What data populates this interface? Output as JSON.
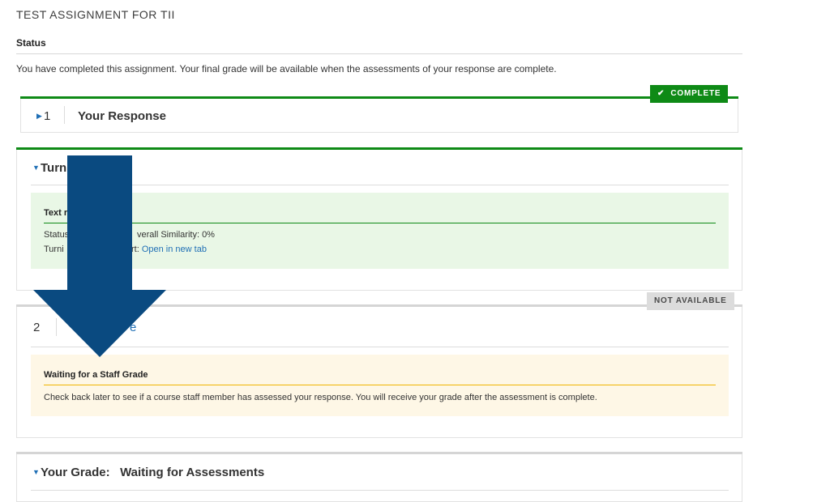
{
  "page": {
    "title": "TEST ASSIGNMENT FOR TII",
    "status_heading": "Status",
    "status_message": "You have completed this assignment. Your final grade will be available when the assessments of your response are complete."
  },
  "step1": {
    "number": "1",
    "title": "Your Response",
    "badge": "COMPLETE"
  },
  "turnitin": {
    "title_visible": "Turn",
    "box_label_visible": "Text r",
    "line1_left": "Status",
    "line1_right": "verall Similarity: 0%",
    "line2_left": "Turni",
    "line2_mid": "rt: ",
    "link": "Open in new tab"
  },
  "step2": {
    "number": "2",
    "title_visible": "e",
    "badge": "NOT AVAILABLE",
    "box_label": "Waiting for a Staff Grade",
    "box_text": "Check back later to see if a course staff member has assessed your response. You will receive your grade after the assessment is complete."
  },
  "grade": {
    "title": "Your Grade:   Waiting for Assessments"
  },
  "colors": {
    "complete": "#0e8a16",
    "link": "#1f6fb5",
    "arrow": "#0a4a80",
    "success_bg": "#e9f7e6",
    "warning_bg": "#fef7e6"
  },
  "icons": {
    "complete_badge": "check-icon",
    "expand": "caret-icon",
    "overlay": "down-arrow-annotation"
  }
}
